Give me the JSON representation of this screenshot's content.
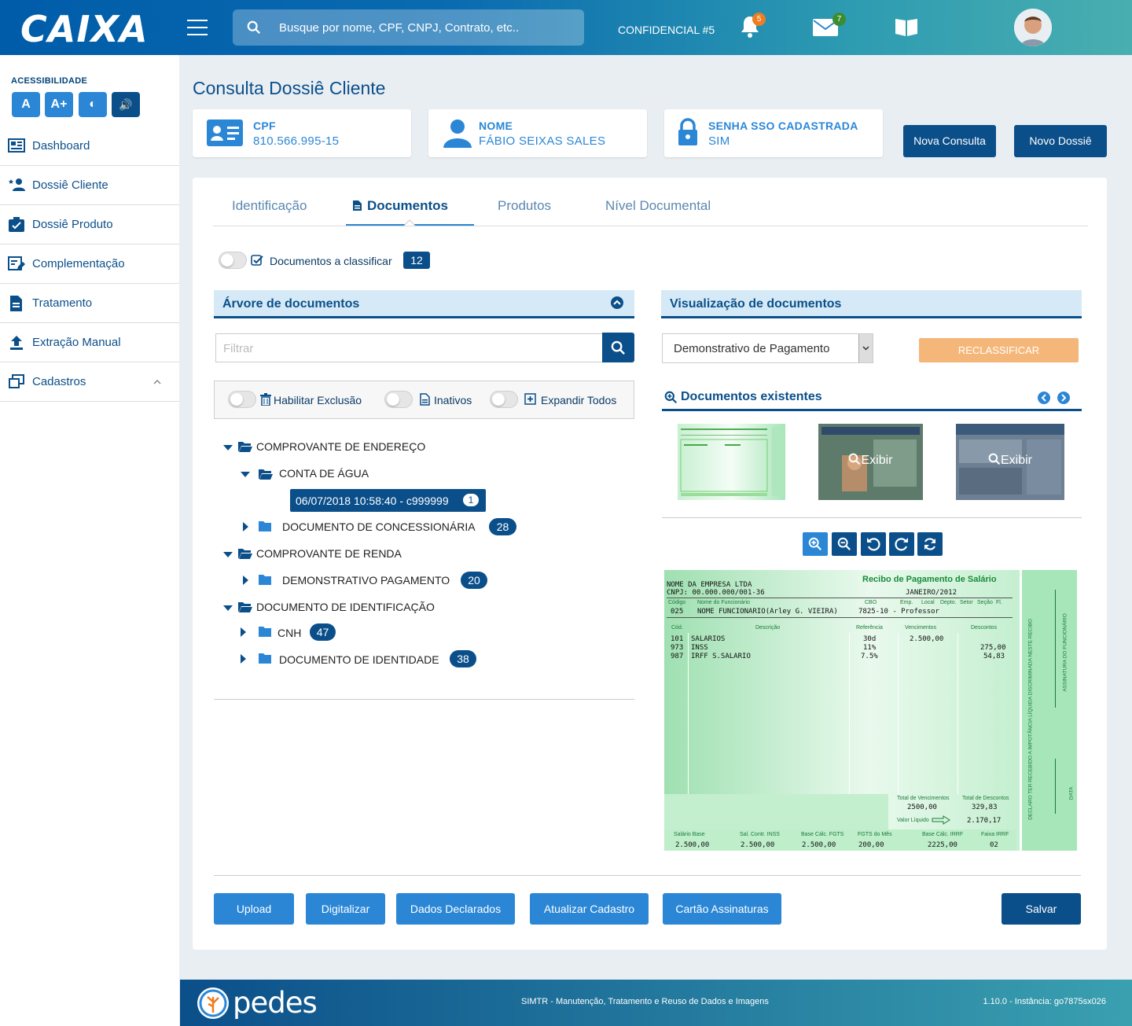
{
  "header": {
    "logo": "CAIXA",
    "search_placeholder": "Busque por nome, CPF, CNPJ, Contrato, etc..",
    "confidential": "CONFIDENCIAL #5",
    "notif_count": "5",
    "mail_count": "7"
  },
  "accessibility": {
    "label": "ACESSIBILIDADE",
    "b1": "A",
    "b2": "A+",
    "b3": "◐",
    "b4": "🔊"
  },
  "sidebar": {
    "items": [
      {
        "label": "Dashboard"
      },
      {
        "label": "Dossiê Cliente"
      },
      {
        "label": "Dossiê Produto"
      },
      {
        "label": "Complementação"
      },
      {
        "label": "Tratamento"
      },
      {
        "label": "Extração Manual"
      },
      {
        "label": "Cadastros"
      }
    ]
  },
  "page": {
    "title": "Consulta Dossiê Cliente"
  },
  "cards": {
    "cpf_label": "CPF",
    "cpf_value": "810.566.995-15",
    "nome_label": "NOME",
    "nome_value": "FÁBIO SEIXAS SALES",
    "senha_label": "SENHA SSO CADASTRADA",
    "senha_value": "SIM"
  },
  "buttons": {
    "nova_consulta": "Nova Consulta",
    "novo_dossie": "Novo Dossiê",
    "reclassificar": "RECLASSIFICAR"
  },
  "tabs": [
    {
      "label": "Identificação"
    },
    {
      "label": "Documentos"
    },
    {
      "label": "Produtos"
    },
    {
      "label": "Nível Documental"
    }
  ],
  "classify": {
    "label": "Documentos a classificar",
    "count": "12"
  },
  "tree_panel": {
    "title": "Árvore de documentos",
    "filter_placeholder": "Filtrar",
    "opt_exclusao": "Habilitar Exclusão",
    "opt_inativos": "Inativos",
    "opt_expandir": "Expandir Todos"
  },
  "tree": {
    "n1": "COMPROVANTE DE ENDEREÇO",
    "n1a": "CONTA DE ÁGUA",
    "n1a_sel": "06/07/2018 10:58:40 - c999999",
    "n1a_sel_count": "1",
    "n1b": "DOCUMENTO DE CONCESSIONÁRIA",
    "n1b_count": "28",
    "n2": "COMPROVANTE DE RENDA",
    "n2a": "DEMONSTRATIVO PAGAMENTO",
    "n2a_count": "20",
    "n3": "DOCUMENTO DE IDENTIFICAÇÃO",
    "n3a": "CNH",
    "n3a_count": "47",
    "n3b": "DOCUMENTO DE IDENTIDADE",
    "n3b_count": "38"
  },
  "viewer": {
    "title": "Visualização de documentos",
    "selected_type": "Demonstrativo de Pagamento",
    "existing_title": "Documentos existentes",
    "exibir": "Exibir"
  },
  "payslip": {
    "company": "NOME DA EMPRESA LTDA",
    "cnpj": "CNPJ: 00.000.000/001-36",
    "title": "Recibo de Pagamento de Salário",
    "month": "JANEIRO/2012",
    "h_codigo": "Código",
    "h_nome": "Nome do Funcionário",
    "h_cbo": "CBO",
    "h_emp": "Emp.",
    "h_local": "Local",
    "h_depto": "Depto.",
    "h_setor": "Setor",
    "h_secao": "Seção",
    "h_fl": "Fl.",
    "code": "025",
    "employee": "NOME FUNCIONARIO(Arley G. VIEIRA)",
    "cbo": "7825-10 - Professor",
    "c_cod": "Cód.",
    "c_desc": "Descrição",
    "c_ref": "Referência",
    "c_venc": "Vencimentos",
    "c_desc2": "Descontos",
    "rows": [
      {
        "cod": "101",
        "desc": "SALARIOS",
        "ref": "30d",
        "venc": "2.500,00",
        "dsc": ""
      },
      {
        "cod": "973",
        "desc": "INSS",
        "ref": "11%",
        "venc": "",
        "dsc": "275,00"
      },
      {
        "cod": "987",
        "desc": "IRFF S.SALARIO",
        "ref": "7.5%",
        "venc": "",
        "dsc": "54,83"
      }
    ],
    "tot_venc_label": "Total de Vencimentos",
    "tot_venc": "2500,00",
    "tot_desc_label": "Total de Descontos",
    "tot_desc": "329,83",
    "liq_label": "Valor Líquido",
    "liq": "2.170,17",
    "f_sal": "Salário Base",
    "f_sal_v": "2.500,00",
    "f_inss": "Sal. Contr. INSS",
    "f_inss_v": "2.500,00",
    "f_fgts": "Base Cálc. FGTS",
    "f_fgts_v": "2.500,00",
    "f_fgtsm": "FGTS do Mês",
    "f_fgtsm_v": "200,00",
    "f_irrf": "Base Cálc. IRRF",
    "f_irrf_v": "2225,00",
    "f_faixa": "Faixa IRRF",
    "f_faixa_v": "02",
    "side1": "DECLARO TER RECEBIDO A IMPOTÂNCIA LÍQUIDA DISCRIMINADA NESTE RECIBO",
    "side2": "ASSINATURA DO FUNCIONÁRIO",
    "side3": "DATA"
  },
  "actions": {
    "upload": "Upload",
    "digitalizar": "Digitalizar",
    "dados": "Dados Declarados",
    "atualizar": "Atualizar Cadastro",
    "cartao": "Cartão Assinaturas",
    "salvar": "Salvar"
  },
  "footer": {
    "logo": "pedes",
    "center": "SIMTR - Manutenção, Tratamento e Reuso de Dados e Imagens",
    "version": "1.10.0 - Instância: go7875sx026"
  }
}
